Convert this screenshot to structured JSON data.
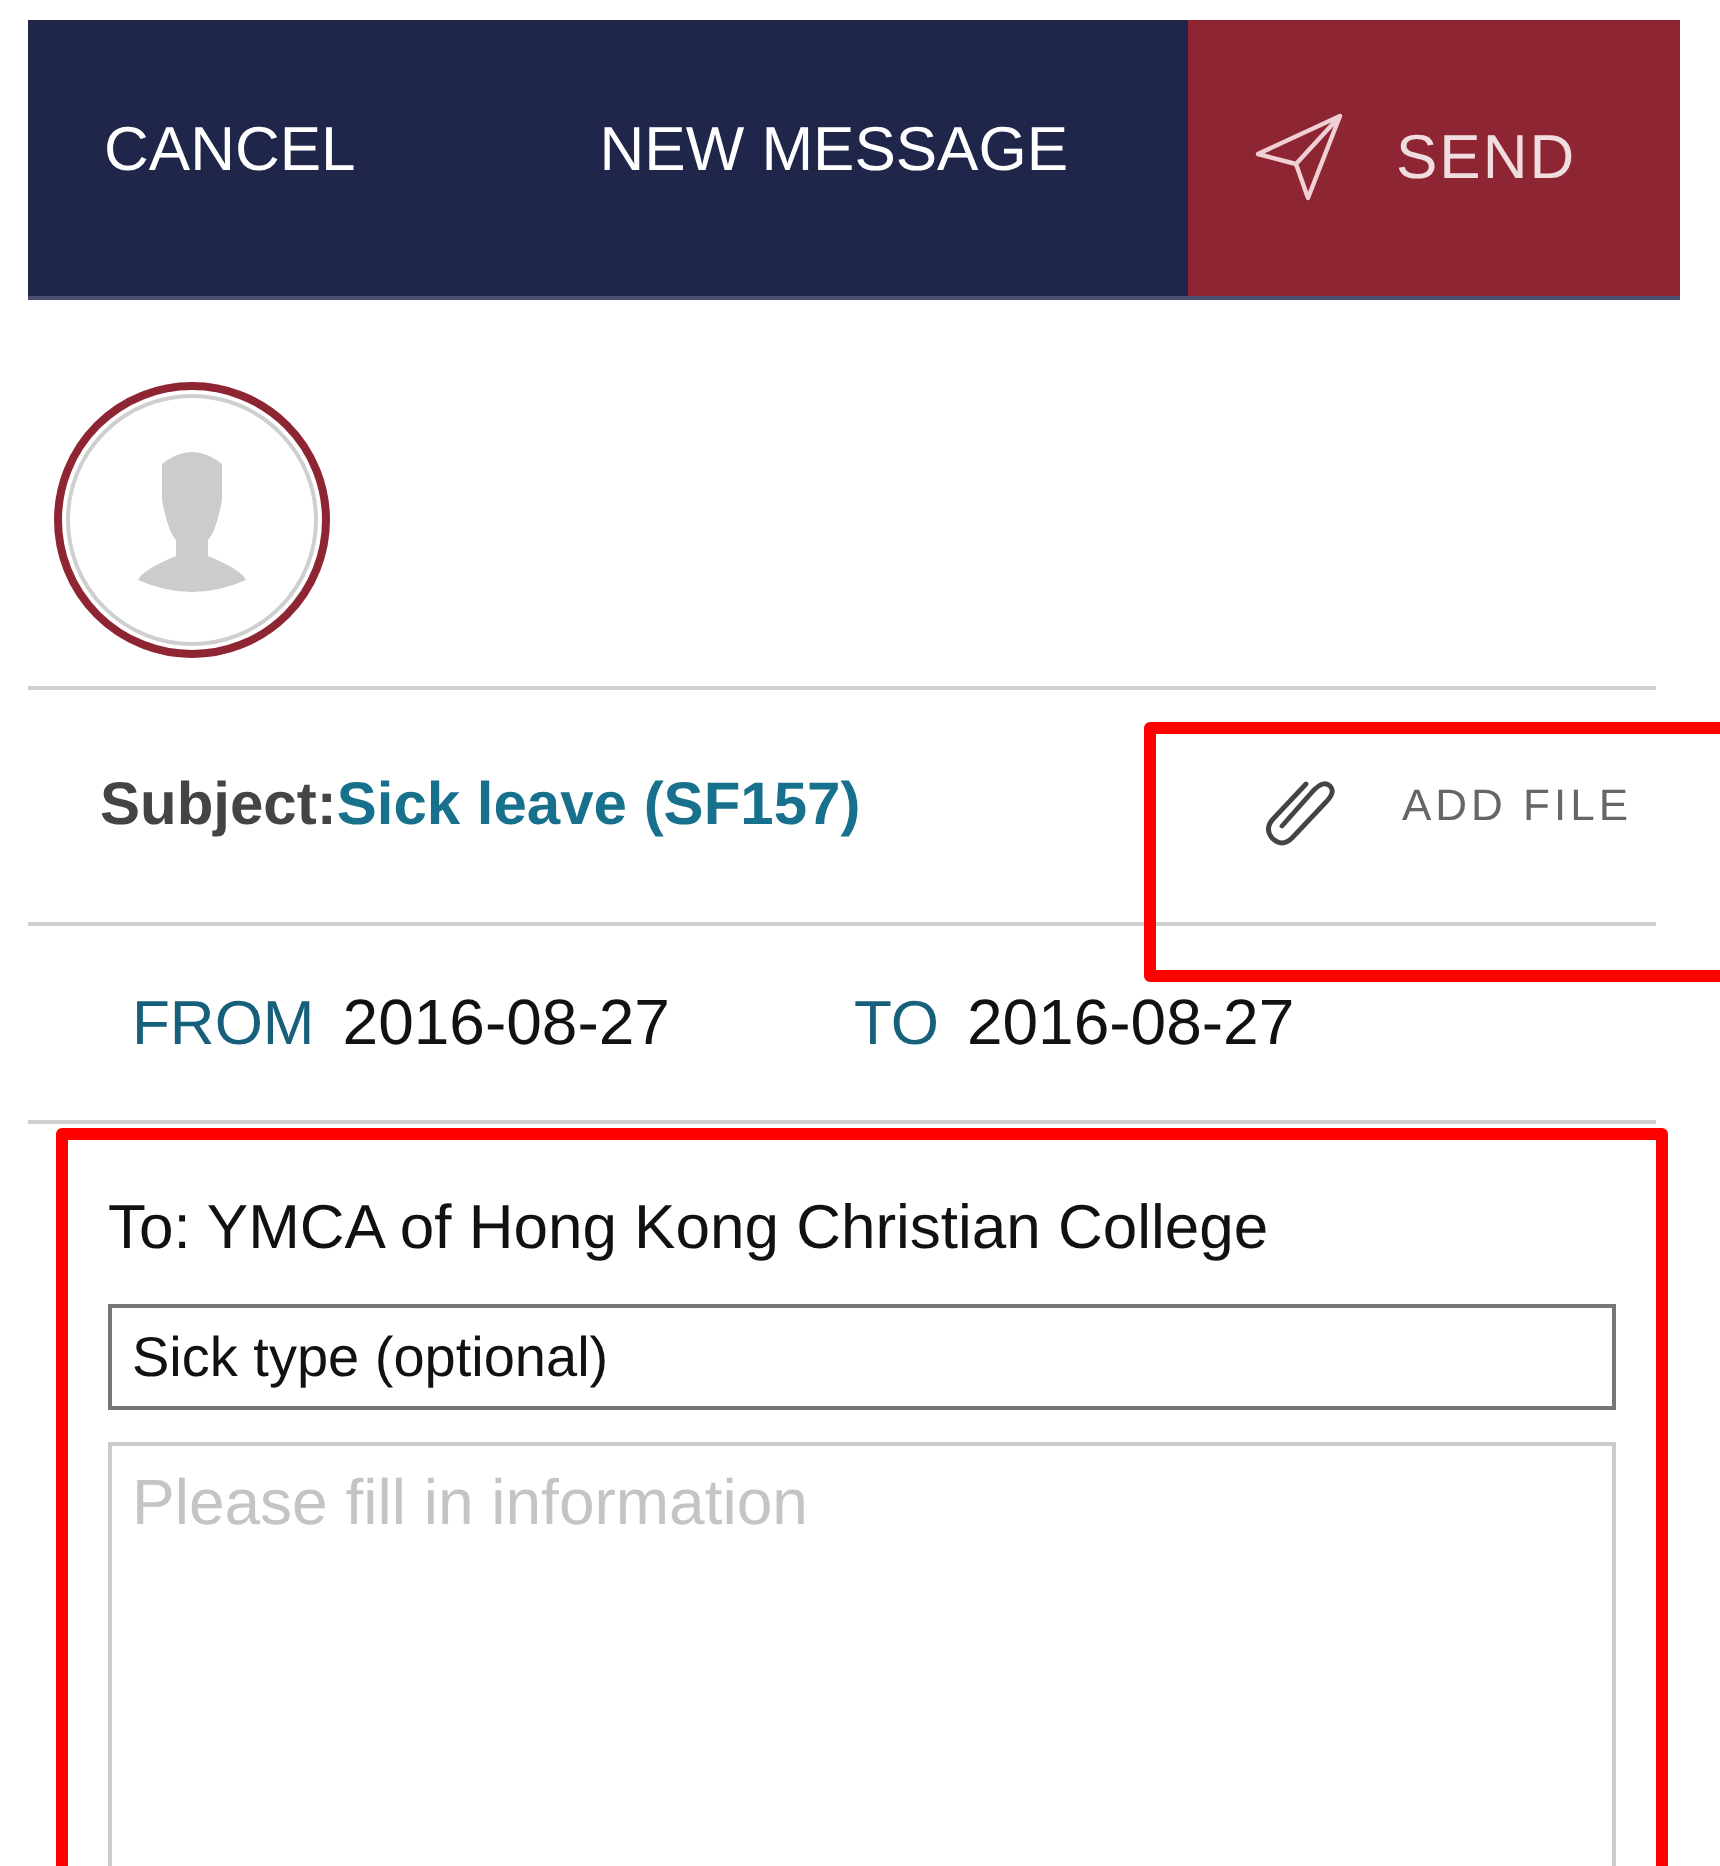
{
  "header": {
    "cancel": "CANCEL",
    "title": "NEW MESSAGE",
    "send": "SEND"
  },
  "subject": {
    "label": "Subject:",
    "value": "Sick leave (SF157)"
  },
  "add_file": {
    "label": "ADD FILE",
    "highlighted": true
  },
  "dates": [
    {
      "label": "FROM",
      "value": "2016-08-27"
    },
    {
      "label": "TO",
      "value": "2016-08-27"
    }
  ],
  "form": {
    "highlighted": true,
    "recipient": "To: YMCA of Hong Kong Christian College",
    "sick_type": "Sick type (optional)",
    "details_placeholder": "Please fill in information"
  }
}
